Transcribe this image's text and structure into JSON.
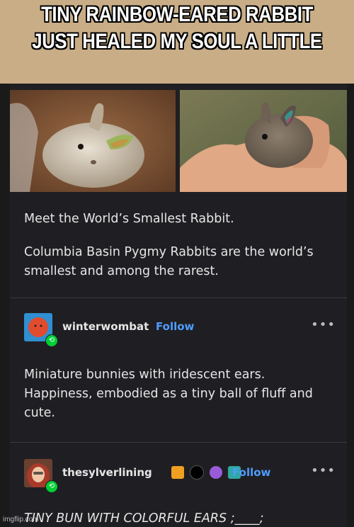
{
  "meme": {
    "title_line1": "TINY RAINBOW-EARED RABBIT",
    "title_line2": "JUST HEALED MY SOUL A LITTLE",
    "watermark": "imgflip.com"
  },
  "post": {
    "heading": "Meet the World’s Smallest Rabbit.",
    "body": "Columbia Basin Pygmy Rabbits are the world’s smallest and among the rarest."
  },
  "reblog1": {
    "username": "winterwombat",
    "follow_label": "Follow",
    "more_label": "•••",
    "text": "Miniature bunnies with iridescent ears. Happiness, embodied as a tiny ball of fluff and cute."
  },
  "reblog2": {
    "username": "thesylverlining",
    "follow_label": "Follow",
    "more_label": "•••",
    "text": "TINY BUN WITH COLORFUL EARS ;____;"
  },
  "colors": {
    "meme_bg": "#c8ad86",
    "post_bg": "#1f1f23",
    "follow_blue": "#4f9dff",
    "reblog_green": "#00cf35"
  }
}
